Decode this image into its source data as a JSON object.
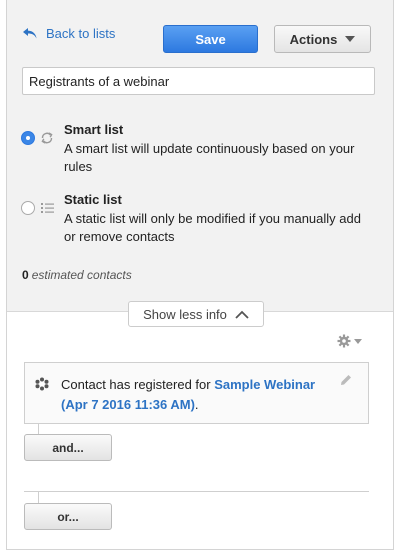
{
  "header": {
    "back_label": "Back to lists",
    "save_label": "Save",
    "actions_label": "Actions"
  },
  "list_name": {
    "value": "Registrants of a webinar"
  },
  "options": {
    "smart": {
      "title": "Smart list",
      "description": "A smart list will update continuously based on your rules",
      "checked": true
    },
    "static": {
      "title": "Static list",
      "description": "A static list will only be modified if you manually add or remove contacts",
      "checked": false
    }
  },
  "estimate": {
    "count": "0",
    "label": "estimated contacts"
  },
  "toggle_info_label": "Show less info",
  "rule": {
    "prefix": "Contact has registered for",
    "link_text": "Sample Webinar (Apr 7 2016 11:36 AM)",
    "suffix": "."
  },
  "buttons": {
    "and_label": "and...",
    "or_label": "or..."
  },
  "colors": {
    "accent": "#2d79e0",
    "link": "#2d73c4",
    "panel_bg": "#f2f2f2"
  },
  "icons": {
    "back": "back-arrow-icon",
    "smart": "refresh-icon",
    "static": "list-icon",
    "toggle": "chevron-up-icon",
    "settings": "gear-icon",
    "rule": "webinar-icon",
    "edit": "pencil-icon"
  }
}
